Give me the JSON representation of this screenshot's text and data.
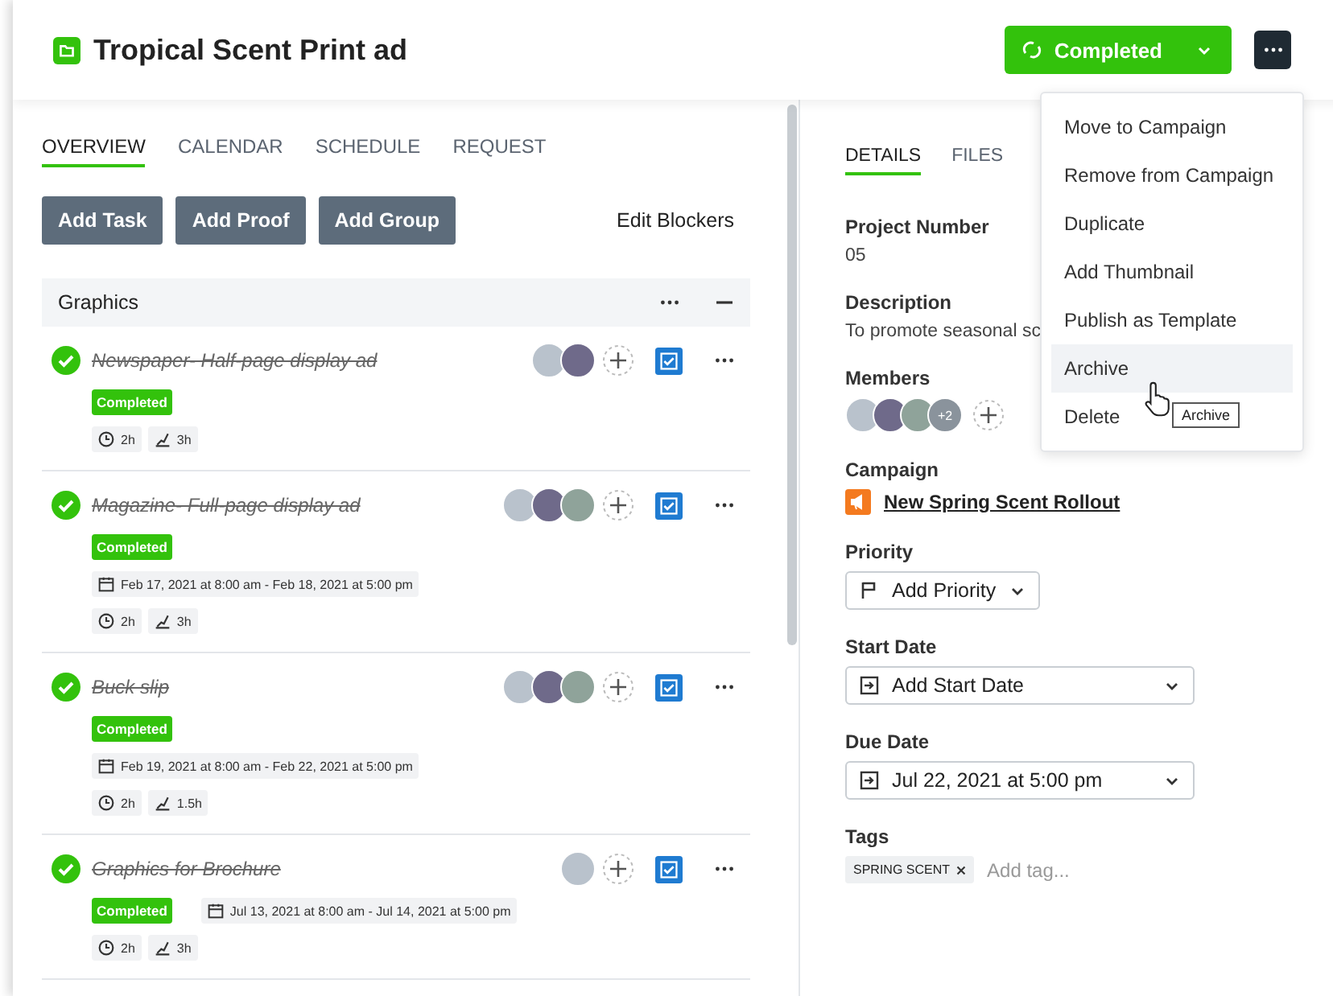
{
  "header": {
    "title": "Tropical Scent Print ad",
    "status_button": "Completed",
    "status_completed": true
  },
  "left_tabs": [
    {
      "label": "OVERVIEW",
      "selected": true
    },
    {
      "label": "CALENDAR",
      "selected": false
    },
    {
      "label": "SCHEDULE",
      "selected": false
    },
    {
      "label": "REQUEST",
      "selected": false
    }
  ],
  "actions": [
    "Add Task",
    "Add Proof",
    "Add Group"
  ],
  "edit_blockers": "Edit Blockers",
  "group": {
    "name": "Graphics",
    "expanded": true,
    "tasks": [
      {
        "name": "Newspaper- Half-page display ad",
        "completed": true,
        "status": "Completed",
        "estimate": "2h",
        "tracked": "3h",
        "assignees": [
          {
            "kind": "photo"
          },
          {
            "kind": "photo"
          }
        ]
      },
      {
        "kind": "stacked",
        "name": "Magazine- Full-page display ad",
        "completed": true,
        "status": "Completed",
        "dates": "Feb 17, 2021 at 8:00 am - Feb 18, 2021 at 5:00 pm",
        "estimate": "2h",
        "tracked": "3h",
        "assignees": [
          {
            "kind": "photo"
          },
          {
            "kind": "photo"
          },
          {
            "kind": "photo"
          }
        ]
      },
      {
        "kind": "stacked",
        "name": "Buck slip",
        "completed": true,
        "status": "Completed",
        "dates": "Feb 19, 2021 at 8:00 am - Feb 22, 2021 at 5:00 pm",
        "estimate": "2h",
        "tracked": "1.5h",
        "assignees": [
          {
            "kind": "photo"
          },
          {
            "kind": "photo"
          },
          {
            "kind": "photo"
          }
        ]
      },
      {
        "kind": "inline",
        "name": "Graphics for Brochure",
        "completed": true,
        "status": "Completed",
        "dates": "Jul 13, 2021 at 8:00 am - Jul 14, 2021 at 5:00 pm",
        "estimate": "2h",
        "tracked": "3h",
        "assignees": [
          {
            "kind": "photo"
          }
        ]
      }
    ]
  },
  "right_tabs": [
    {
      "label": "DETAILS",
      "selected": true
    },
    {
      "label": "FILES",
      "selected": false
    }
  ],
  "details": {
    "project_number_label": "Project Number",
    "project_number": "05",
    "description_label": "Description",
    "description": "To promote seasonal sc",
    "members_label": "Members",
    "members_more": "+2",
    "campaign_label": "Campaign",
    "campaign": "New Spring Scent Rollout",
    "priority_label": "Priority",
    "priority": "Add Priority",
    "start_label": "Start Date",
    "start": "Add Start Date",
    "due_label": "Due Date",
    "due": "Jul 22, 2021 at 5:00 pm",
    "tags_label": "Tags",
    "tags": [
      "SPRING SCENT"
    ],
    "tag_placeholder": "Add tag..."
  },
  "menu": {
    "items": [
      {
        "label": "Move to Campaign",
        "selected": false
      },
      {
        "label": "Remove from Campaign",
        "selected": false
      },
      {
        "label": "Duplicate",
        "selected": false
      },
      {
        "label": "Add Thumbnail",
        "selected": false
      },
      {
        "label": "Publish as Template",
        "selected": false
      },
      {
        "label": "Archive",
        "selected": true
      },
      {
        "label": "Delete",
        "selected": false
      }
    ],
    "tooltip": "Archive"
  }
}
